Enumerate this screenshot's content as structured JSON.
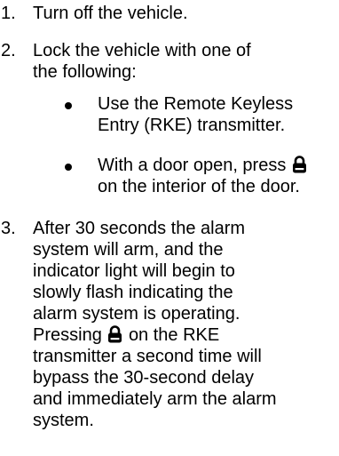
{
  "steps": [
    {
      "number": "1.",
      "lines": [
        "Turn off the vehicle."
      ]
    },
    {
      "number": "2.",
      "lines": [
        "Lock the vehicle with one of",
        "the following:"
      ],
      "bullets": [
        {
          "lines": [
            "Use the Remote Keyless",
            "Entry (RKE) transmitter."
          ]
        },
        {
          "line1_before_icon": "With a door open, press",
          "icon": "lock-icon",
          "line2": "on the interior of the door."
        }
      ]
    },
    {
      "number": "3.",
      "lines": [
        "After 30 seconds the alarm",
        "system will arm, and the",
        "indicator light will begin to",
        "slowly flash indicating the",
        "alarm system is operating."
      ],
      "para2_line1_before_icon": "Pressing",
      "para2_icon": "lock-icon",
      "para2_line1_after_icon": "on the RKE",
      "para2_lines": [
        "transmitter a second time will",
        "bypass the 30-second delay",
        "and immediately arm the alarm",
        "system."
      ]
    }
  ]
}
